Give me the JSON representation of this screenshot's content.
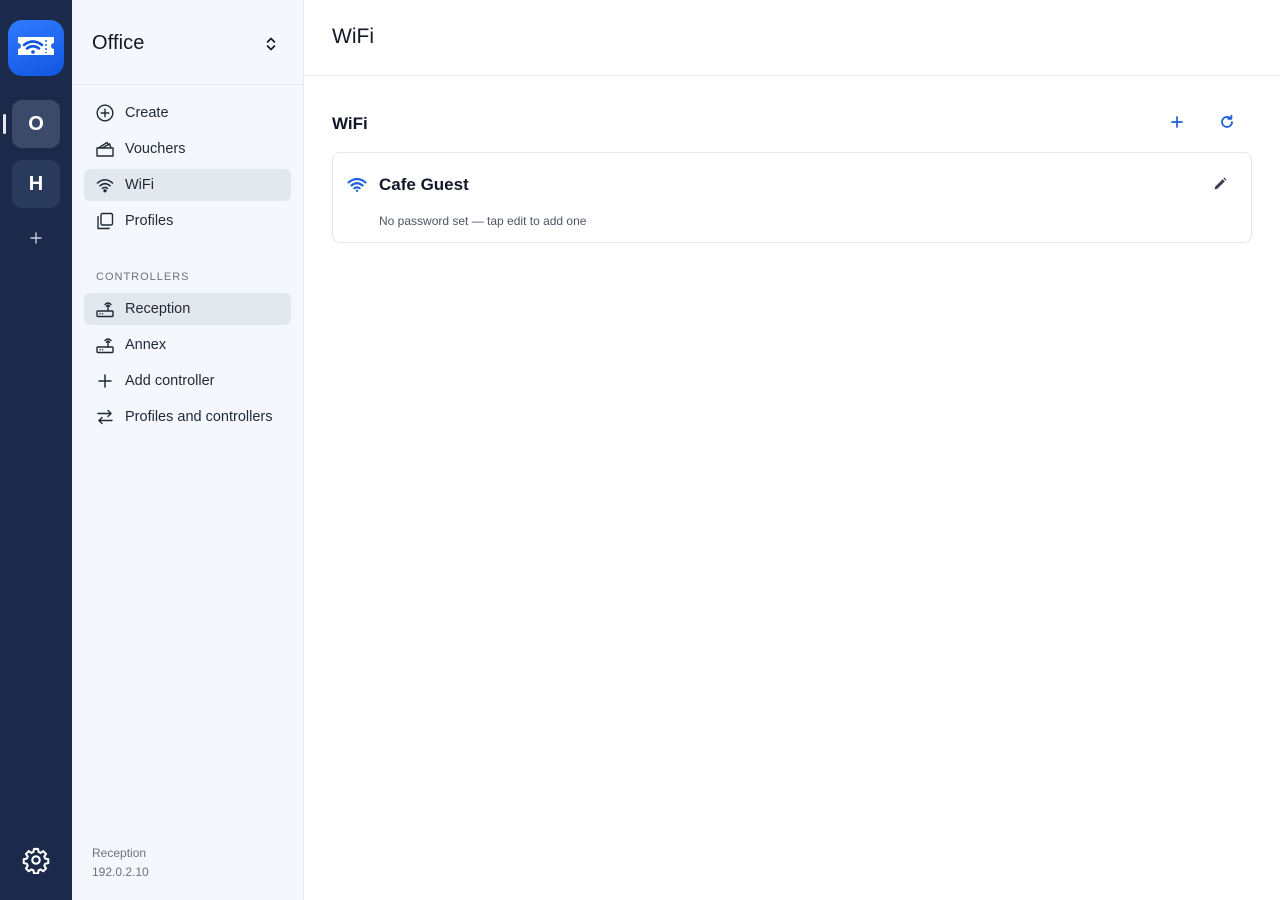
{
  "rail": {
    "workspaces": [
      {
        "initial": "O",
        "active": true
      },
      {
        "initial": "H",
        "active": false
      }
    ],
    "icons": {
      "logo": "wifi-ticket-icon",
      "add": "plus-icon",
      "settings": "gear-icon"
    }
  },
  "sidebar": {
    "title": "Office",
    "switcher_icon": "chevron-up-down-icon",
    "nav": [
      {
        "label": "Create",
        "icon": "plus-circle-icon"
      },
      {
        "label": "Vouchers",
        "icon": "ticket-icon"
      },
      {
        "label": "WiFi",
        "icon": "wifi-icon",
        "selected": true
      },
      {
        "label": "Profiles",
        "icon": "stack-icon"
      }
    ],
    "controllers_label": "CONTROLLERS",
    "controllers": [
      {
        "label": "Reception",
        "icon": "router-icon",
        "selected": true
      },
      {
        "label": "Annex",
        "icon": "router-icon"
      },
      {
        "label": "Add controller",
        "icon": "plus-icon"
      },
      {
        "label": "Profiles and controllers",
        "icon": "arrows-swap-icon"
      }
    ],
    "footer": {
      "name": "Reception",
      "ip": "192.0.2.10"
    }
  },
  "main": {
    "page_title": "WiFi",
    "section_title": "WiFi",
    "networks": [
      {
        "name": "Cafe Guest",
        "subtitle": "No password set — tap edit to add one"
      }
    ]
  },
  "colors": {
    "accent": "#1f5fd9",
    "rail": "#1b2a4a",
    "sidebar": "#f4f7fc"
  }
}
